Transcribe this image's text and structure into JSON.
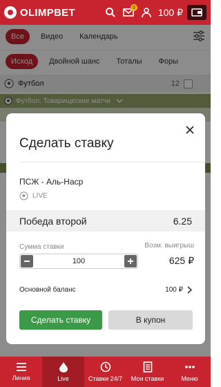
{
  "header": {
    "brand": "OLIMPBET",
    "notifications_count": "0",
    "balance": "100 ₽"
  },
  "top_tabs": [
    {
      "label": "Все",
      "active": true
    },
    {
      "label": "Видео"
    },
    {
      "label": "Календарь"
    }
  ],
  "bet_tabs": [
    {
      "label": "Исход",
      "active": true
    },
    {
      "label": "Двойной шанс"
    },
    {
      "label": "Тоталы"
    },
    {
      "label": "Форы"
    }
  ],
  "sport_row": {
    "label": "Футбол",
    "count": "12"
  },
  "league_row": {
    "label": "Футбол. Товарищеские матчи"
  },
  "modal": {
    "title": "Сделать ставку",
    "match": "ПСЖ - Аль-Наср",
    "live_label": "LIVE",
    "outcome": "Победа второй",
    "odds": "6.25",
    "stake_label": "Сумма ставки",
    "stake_value": "100",
    "win_label": "Возм. выигрыш",
    "win_value": "625 ₽",
    "balance_label": "Основной баланс",
    "balance_value": "100 ₽",
    "bet_button": "Сделать ставку",
    "coupon_button": "В купон"
  },
  "bottom_nav": [
    {
      "label": "Линия",
      "icon": "list-icon"
    },
    {
      "label": "Live",
      "icon": "drop-icon",
      "active": true
    },
    {
      "label": "Ставки 24/7",
      "icon": "clock-icon"
    },
    {
      "label": "Мои ставки",
      "icon": "receipt-icon"
    },
    {
      "label": "Меню",
      "icon": "dots-icon"
    }
  ],
  "colors": {
    "brand_red": "#c8242f",
    "accent_green": "#3b9a47",
    "league_green": "#98a86a"
  }
}
